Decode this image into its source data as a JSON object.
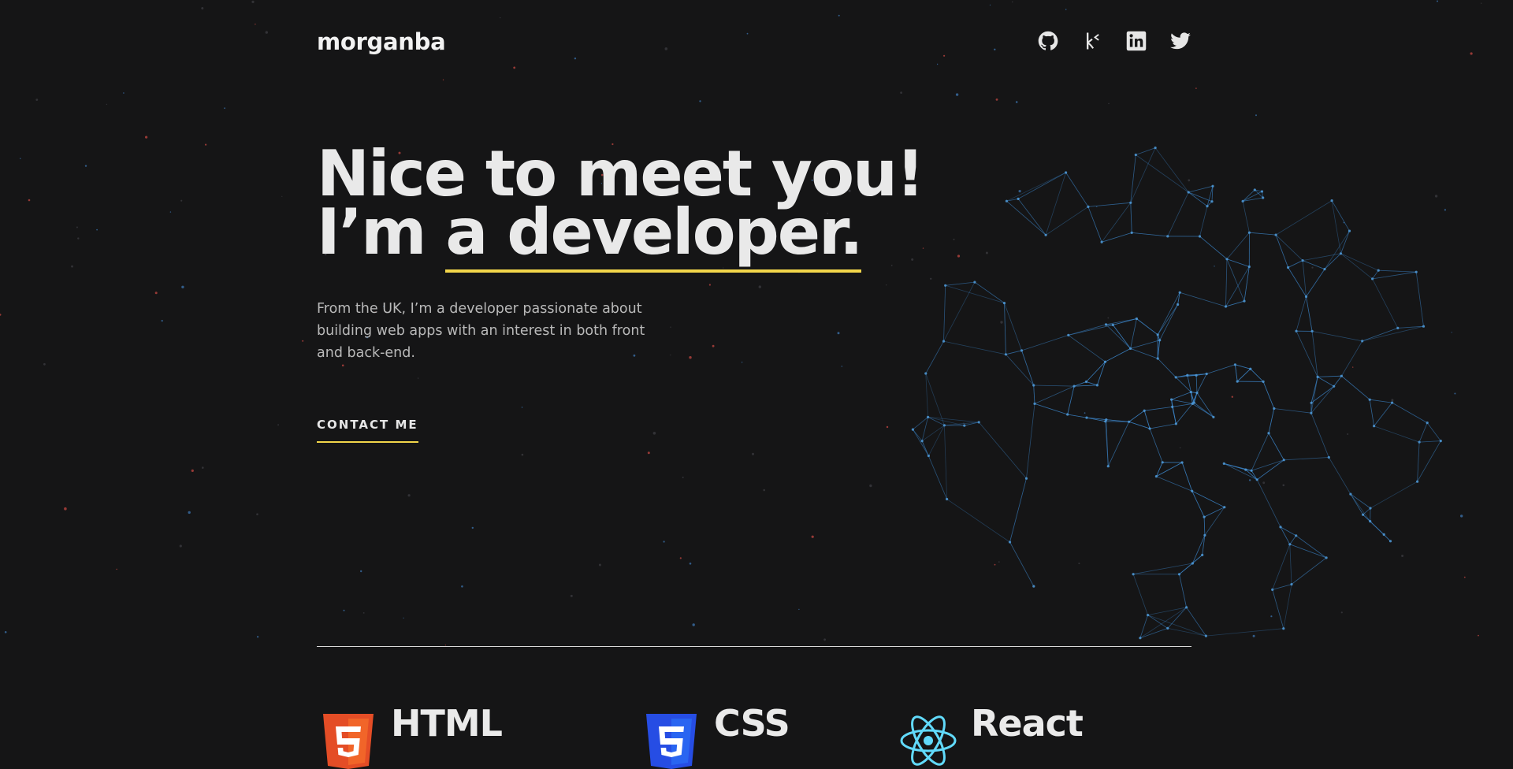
{
  "header": {
    "brand": "morganba",
    "socials": [
      {
        "name": "github",
        "icon": "github-icon"
      },
      {
        "name": "kaggle",
        "icon": "kaggle-icon"
      },
      {
        "name": "linkedin",
        "icon": "linkedin-icon"
      },
      {
        "name": "twitter",
        "icon": "twitter-icon"
      }
    ]
  },
  "hero": {
    "line1": "Nice to meet you!",
    "line2_prefix": "I’m ",
    "line2_highlight": "a developer.",
    "intro": "From the UK, I’m a developer passionate about building web apps with an interest in both front and back-end.",
    "contact": "CONTACT ME"
  },
  "skills": [
    {
      "name": "HTML",
      "icon": "html5-icon",
      "color": "#e44d26"
    },
    {
      "name": "CSS",
      "icon": "css3-icon",
      "color": "#264de4"
    },
    {
      "name": "React",
      "icon": "react-icon",
      "color": "#61dafb"
    }
  ],
  "colors": {
    "background": "#151516",
    "accent": "#f2d54a",
    "network": "#3b82c4"
  }
}
